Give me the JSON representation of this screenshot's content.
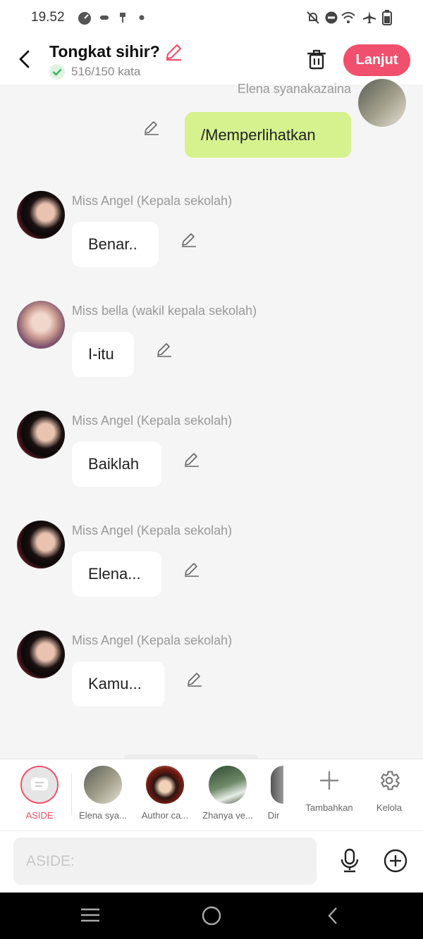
{
  "status_bar": {
    "time": "19.52"
  },
  "header": {
    "title": "Tongkat sihir?",
    "word_count": "516/150 kata",
    "next_button": "Lanjut"
  },
  "messages": [
    {
      "sender": "Elena syanakazaina",
      "text": "/Memperlihatkan"
    },
    {
      "sender": "Miss Angel (Kepala sekolah)",
      "text": "Benar.."
    },
    {
      "sender": "Miss bella (wakil kepala sekolah)",
      "text": "I-itu"
    },
    {
      "sender": "Miss Angel (Kepala sekolah)",
      "text": "Baiklah"
    },
    {
      "sender": "Miss Angel (Kepala sekolah)",
      "text": "Elena..."
    },
    {
      "sender": "Miss Angel (Kepala sekolah)",
      "text": "Kamu..."
    }
  ],
  "characters": [
    {
      "label": "ASIDE"
    },
    {
      "label": "Elena sya..."
    },
    {
      "label": "Author ca..."
    },
    {
      "label": "Zhanya ve..."
    },
    {
      "label": "Dir"
    }
  ],
  "actions": {
    "add": "Tambahkan",
    "manage": "Kelola"
  },
  "input": {
    "placeholder": "ASIDE:"
  },
  "colors": {
    "accent": "#f0506e",
    "my_bubble": "#d6f28f",
    "check": "#3fb65a"
  }
}
